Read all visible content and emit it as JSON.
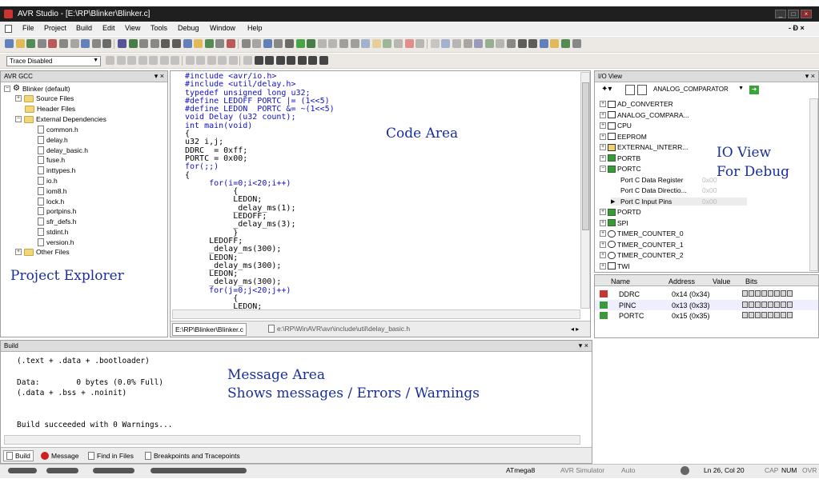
{
  "window": {
    "title": "AVR Studio - [E:\\RP\\Blinker\\Blinker.c]"
  },
  "menu": [
    "File",
    "Project",
    "Build",
    "Edit",
    "View",
    "Tools",
    "Debug",
    "Window",
    "Help"
  ],
  "mdi_controls": "- Ɖ ×",
  "toolbar3": {
    "trace_label": "Trace Disabled"
  },
  "explorer": {
    "title": "AVR GCC",
    "root": "Blinker (default)",
    "folders": [
      "Source Files",
      "Header Files",
      "External Dependencies",
      "Other Files"
    ],
    "deps": [
      "common.h",
      "delay.h",
      "delay_basic.h",
      "fuse.h",
      "inttypes.h",
      "io.h",
      "iom8.h",
      "lock.h",
      "portpins.h",
      "sfr_defs.h",
      "stdint.h",
      "version.h"
    ]
  },
  "editor": {
    "lines": [
      "#include <avr/io.h>",
      "#include <util/delay.h>",
      "typedef unsigned long u32;",
      "#define LEDOFF PORTC |= (1<<5)",
      "#define LEDON  PORTC &= ~(1<<5)",
      "void Delay (u32 count);",
      "int main(void)",
      "{",
      "u32 i,j;",
      "DDRC  = 0xff;",
      "PORTC = 0x00;",
      "for(;;)",
      "{",
      "     for(i=0;i<20;i++)",
      "          {",
      "          LEDON;",
      "          _delay_ms(1);",
      "          LEDOFF;",
      "          _delay_ms(3);",
      "          }",
      "     LEDOFF;",
      "     _delay_ms(300);",
      "     LEDON;",
      "     _delay_ms(300);",
      "     LEDON;",
      "     _delay_ms(300);",
      "     for(j=0;j<20;j++)",
      "          {",
      "          LEDON;"
    ],
    "tabs": [
      "E:\\RP\\Blinker\\Blinker.c",
      "e:\\RP\\WinAVR\\avr\\include\\util\\delay_basic.h"
    ]
  },
  "ioview": {
    "title": "I/O View",
    "device_combo": "ANALOG_COMPARATOR",
    "items": [
      "AD_CONVERTER",
      "ANALOG_COMPARA...",
      "CPU",
      "EEPROM",
      "EXTERNAL_INTERR...",
      "PORTB",
      "PORTC",
      "PORTD",
      "SPI",
      "TIMER_COUNTER_0",
      "TIMER_COUNTER_1",
      "TIMER_COUNTER_2",
      "TWI"
    ],
    "portc_children": [
      {
        "name": "Port C Data Register",
        "val": "0x00"
      },
      {
        "name": "Port C Data Directio...",
        "val": "0x00"
      },
      {
        "name": "Port C Input Pins",
        "val": "0x00"
      }
    ],
    "columns": [
      "Name",
      "Address",
      "Value",
      "Bits"
    ],
    "rows": [
      {
        "name": "DDRC",
        "address": "0x14 (0x34)"
      },
      {
        "name": "PINC",
        "address": "0x13 (0x33)"
      },
      {
        "name": "PORTC",
        "address": "0x15 (0x35)"
      }
    ]
  },
  "build": {
    "title": "Build",
    "lines": [
      "(.text + .data + .bootloader)",
      "",
      "Data:        0 bytes (0.0% Full)",
      "(.data + .bss + .noinit)",
      "",
      "",
      "Build succeeded with 0 Warnings..."
    ],
    "tabs": [
      "Build",
      "Message",
      "Find in Files",
      "Breakpoints and Tracepoints"
    ]
  },
  "annotations": {
    "code_area": "Code Area",
    "io_view_1": "IO View",
    "io_view_2": "For Debug",
    "project_explorer": "Project Explorer",
    "message_1": "Message Area",
    "message_2": "Shows messages / Errors / Warnings"
  },
  "status": {
    "device": "ATmega8",
    "platform": "AVR Simulator",
    "mode": "Auto",
    "position": "Ln 26, Col 20",
    "cap": "CAP",
    "num": "NUM",
    "ovr": "OVR"
  },
  "colors": {
    "annotation": "#1a2e9a",
    "keyword": "#1010c8",
    "titlebar": "#1f1f1f"
  }
}
